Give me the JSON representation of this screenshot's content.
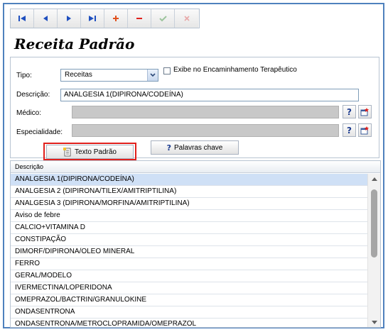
{
  "title": "Receita Padrão",
  "toolbar": {
    "buttons": [
      {
        "name": "first-record-button",
        "icon": "first-icon",
        "color": "#1f4fbf"
      },
      {
        "name": "previous-record-button",
        "icon": "previous-icon",
        "color": "#1f4fbf"
      },
      {
        "name": "next-record-button",
        "icon": "next-icon",
        "color": "#1f4fbf"
      },
      {
        "name": "last-record-button",
        "icon": "last-icon",
        "color": "#1f4fbf"
      },
      {
        "name": "add-record-button",
        "icon": "plus-icon",
        "color": "#e0501c"
      },
      {
        "name": "delete-record-button",
        "icon": "minus-icon",
        "color": "#e0201c"
      },
      {
        "name": "confirm-button",
        "icon": "check-icon",
        "color": "#9cc49c"
      },
      {
        "name": "cancel-button",
        "icon": "close-icon",
        "color": "#e8a8a8"
      }
    ]
  },
  "form": {
    "tipo_label": "Tipo:",
    "tipo_value": "Receitas",
    "exibe_label": "Exibe no Encaminhamento Terapêutico",
    "exibe_checked": false,
    "descricao_label": "Descrição:",
    "descricao_value": "ANALGESIA 1(DIPIRONA/CODEÍNA)",
    "medico_label": "Médico:",
    "medico_value": "",
    "especialidade_label": "Especialidade:",
    "especialidade_value": ""
  },
  "buttons": {
    "texto_padrao": "Texto Padrão",
    "palavras_chave": "Palavras chave",
    "help_symbol": "?"
  },
  "grid": {
    "header": "Descrição",
    "selected_index": 0,
    "rows": [
      "ANALGESIA 1(DIPIRONA/CODEÍNA)",
      "ANALGESIA 2 (DIPIRONA/TILEX/AMITRIPTILINA)",
      "ANALGESIA 3 (DIPIRONA/MORFINA/AMITRIPTILINA)",
      "Aviso de febre",
      "CALCIO+VITAMINA D",
      "CONSTIPAÇÃO",
      "DIMORF/DIPIRONA/OLEO MINERAL",
      "FERRO",
      "GERAL/MODELO",
      "IVERMECTINA/LOPERIDONA",
      "OMEPRAZOL/BACTRIN/GRANULOKINE",
      "ONDASENTRONA",
      "ONDASENTRONA/METROCLOPRAMIDA/OMEPRAZOL"
    ]
  },
  "colors": {
    "accent_border": "#4f81bd",
    "highlight_frame": "#e0201c",
    "selected_row": "#cfe0f6"
  }
}
